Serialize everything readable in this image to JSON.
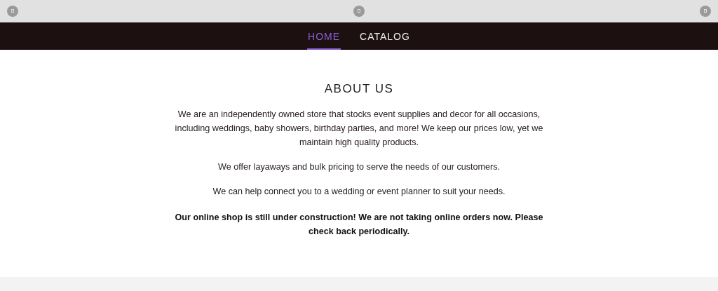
{
  "nav": {
    "items": [
      {
        "label": "HOME",
        "selected": true
      },
      {
        "label": "CATALOG",
        "selected": false
      }
    ]
  },
  "section": {
    "title": "ABOUT US",
    "paragraphs": [
      {
        "kind": "normal",
        "text": "We are an independently owned store that stocks event supplies and decor for all occasions, including weddings, baby showers, birthday parties, and more! We keep our prices low, yet we maintain high quality products."
      },
      {
        "kind": "normal",
        "text": "We offer layaways and bulk pricing to serve the needs of our customers."
      },
      {
        "kind": "normal",
        "text": "We can help connect you to a wedding or event planner to suit your needs."
      },
      {
        "kind": "notice",
        "text": "Our online shop is still under construction! We are not taking online orders now. Please check back periodically."
      }
    ]
  }
}
